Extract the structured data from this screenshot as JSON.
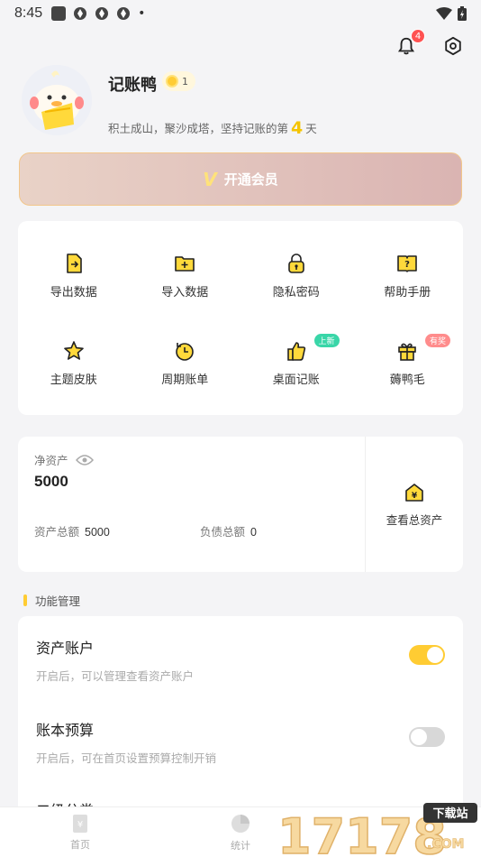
{
  "status_bar": {
    "time": "8:45",
    "dot": "•"
  },
  "header": {
    "notification_count": "4"
  },
  "profile": {
    "name": "记账鸭",
    "level": "1",
    "motto_prefix": "积土成山，聚沙成塔，坚持记账的第",
    "days": "4",
    "motto_suffix": "天"
  },
  "vip": {
    "icon_text": "V",
    "label": "开通会员"
  },
  "grid_items": [
    {
      "label": "导出数据",
      "icon": "export-icon"
    },
    {
      "label": "导入数据",
      "icon": "import-icon"
    },
    {
      "label": "隐私密码",
      "icon": "lock-icon"
    },
    {
      "label": "帮助手册",
      "icon": "help-book-icon"
    },
    {
      "label": "主题皮肤",
      "icon": "star-icon"
    },
    {
      "label": "周期账单",
      "icon": "cycle-icon"
    },
    {
      "label": "桌面记账",
      "icon": "widget-icon",
      "tag": "上新"
    },
    {
      "label": "薅鸭毛",
      "icon": "gift-icon",
      "tag": "有奖"
    }
  ],
  "assets": {
    "net_label": "净资产",
    "net_value": "5000",
    "total_assets_label": "资产总额",
    "total_assets_value": "5000",
    "total_debt_label": "负债总额",
    "total_debt_value": "0",
    "view_all_label": "查看总资产",
    "view_all_icon_text": "¥"
  },
  "function_section": {
    "title": "功能管理",
    "items": [
      {
        "title": "资产账户",
        "desc": "开启后，可以管理查看资产账户",
        "enabled": true
      },
      {
        "title": "账本预算",
        "desc": "开启后，可在首页设置预算控制开销",
        "enabled": false
      },
      {
        "title": "二级分类",
        "desc": "",
        "enabled": false
      }
    ]
  },
  "tabbar": {
    "tabs": [
      {
        "label": "首页",
        "icon_text": "¥"
      },
      {
        "label": "统计"
      }
    ]
  },
  "watermark": {
    "text": "17178",
    "sub": ".COM",
    "badge": "下载站"
  },
  "colors": {
    "accent": "#ffcc33",
    "badge_red": "#ff5252",
    "tag_green": "#39d6a8",
    "tag_red": "#ff8c8c"
  }
}
